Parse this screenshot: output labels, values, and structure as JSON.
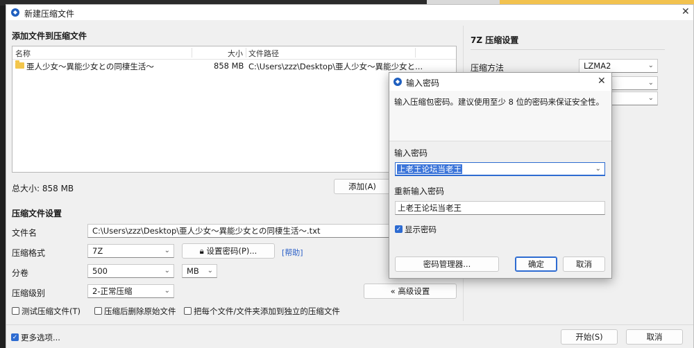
{
  "window": {
    "title": "新建压缩文件",
    "add_section_title": "添加文件到压缩文件",
    "file_list": {
      "columns": {
        "name": "名称",
        "size": "大小",
        "path": "文件路径"
      },
      "rows": [
        {
          "name": "亜人少女～異能少女との同棲生活～",
          "size": "858 MB",
          "path": "C:\\Users\\zzz\\Desktop\\亜人少女～異能少女と..."
        }
      ]
    },
    "total_size": "总大小: 858 MB",
    "add_button": "添加(A)",
    "settings_title": "压缩文件设置",
    "filename_label": "文件名",
    "filename_value": "C:\\Users\\zzz\\Desktop\\亜人少女～異能少女との同棲生活～.txt",
    "format_label": "压缩格式",
    "format_value": "7Z",
    "set_password_button": "设置密码(P)...",
    "help_link": "[帮助]",
    "volume_label": "分卷",
    "volume_value": "500",
    "volume_unit": "MB",
    "level_label": "压缩级别",
    "level_value": "2-正常压缩",
    "advanced_button": "« 高级设置",
    "checkbox_test": "测试压缩文件(T)",
    "checkbox_delete": "压缩后删除原始文件",
    "checkbox_separate": "把每个文件/文件夹添加到独立的压缩文件",
    "more_options": "更多选项...",
    "start_button": "开始(S)",
    "cancel_button": "取消"
  },
  "right_panel": {
    "title": "7Z 压缩设置",
    "method_label": "压缩方法",
    "method_value": "LZMA2"
  },
  "password_dialog": {
    "title": "输入密码",
    "description": "输入压缩包密码。建议使用至少 8 位的密码来保证安全性。",
    "password_label": "输入密码",
    "password_value": "上老王论坛当老王",
    "reenter_label": "重新输入密码",
    "reenter_value": "上老王论坛当老王",
    "show_password": "显示密码",
    "manager_button": "密码管理器...",
    "ok_button": "确定",
    "cancel_button": "取消"
  },
  "colors": {
    "accent": "#2d6bd1",
    "folder": "#f3c64c",
    "selection": "#3b74d9"
  }
}
